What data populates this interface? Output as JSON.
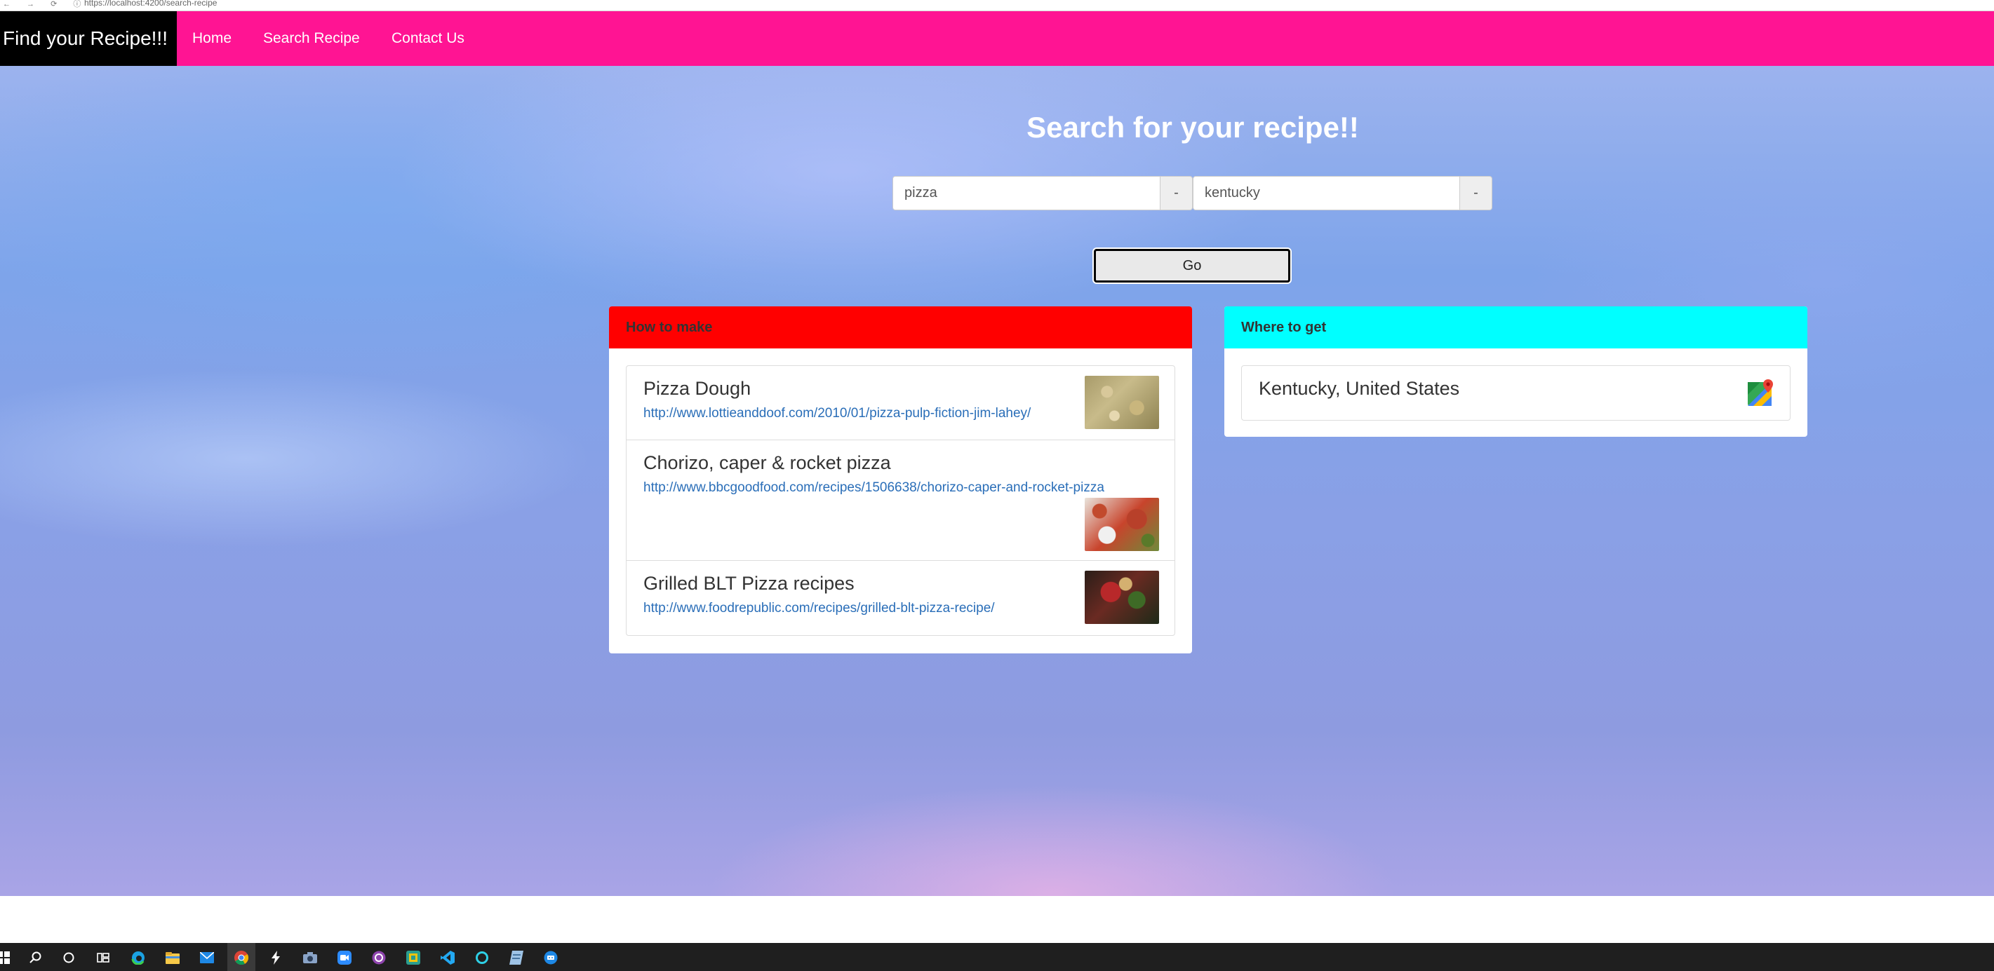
{
  "browser": {
    "url": "https://localhost:4200/search-recipe"
  },
  "navbar": {
    "brand": "Find your Recipe!!!",
    "links": [
      "Home",
      "Search Recipe",
      "Contact Us"
    ]
  },
  "search": {
    "title": "Search for your recipe!!",
    "recipe_value": "pizza",
    "location_value": "kentucky",
    "addon_label": "-",
    "go_label": "Go"
  },
  "how_to_make": {
    "heading": "How to make",
    "heading_color": "#ff0000",
    "items": [
      {
        "title": "Pizza Dough",
        "url": "http://www.lottieanddoof.com/2010/01/pizza-pulp-fiction-jim-lahey/"
      },
      {
        "title": "Chorizo, caper & rocket pizza",
        "url": "http://www.bbcgoodfood.com/recipes/1506638/chorizo-caper-and-rocket-pizza"
      },
      {
        "title": "Grilled BLT Pizza recipes",
        "url": "http://www.foodrepublic.com/recipes/grilled-blt-pizza-recipe/"
      }
    ]
  },
  "where_to_get": {
    "heading": "Where to get",
    "heading_color": "#00ffff",
    "items": [
      {
        "title": "Kentucky, United States",
        "icon": "google-maps-icon"
      }
    ]
  },
  "colors": {
    "navbar": "#ff1493",
    "brand_bg": "#000000",
    "link": "#2a6eb8"
  },
  "taskbar": {
    "icons": [
      "windows-start-icon",
      "search-icon",
      "cortana-icon",
      "task-view-icon",
      "edge-icon",
      "file-explorer-icon",
      "mail-icon",
      "chrome-icon",
      "bolt-icon",
      "camera-icon",
      "zoom-icon",
      "purple-app-icon",
      "teams-icon",
      "vscode-icon",
      "cyan-ring-icon",
      "notes-icon",
      "chat-icon"
    ]
  }
}
